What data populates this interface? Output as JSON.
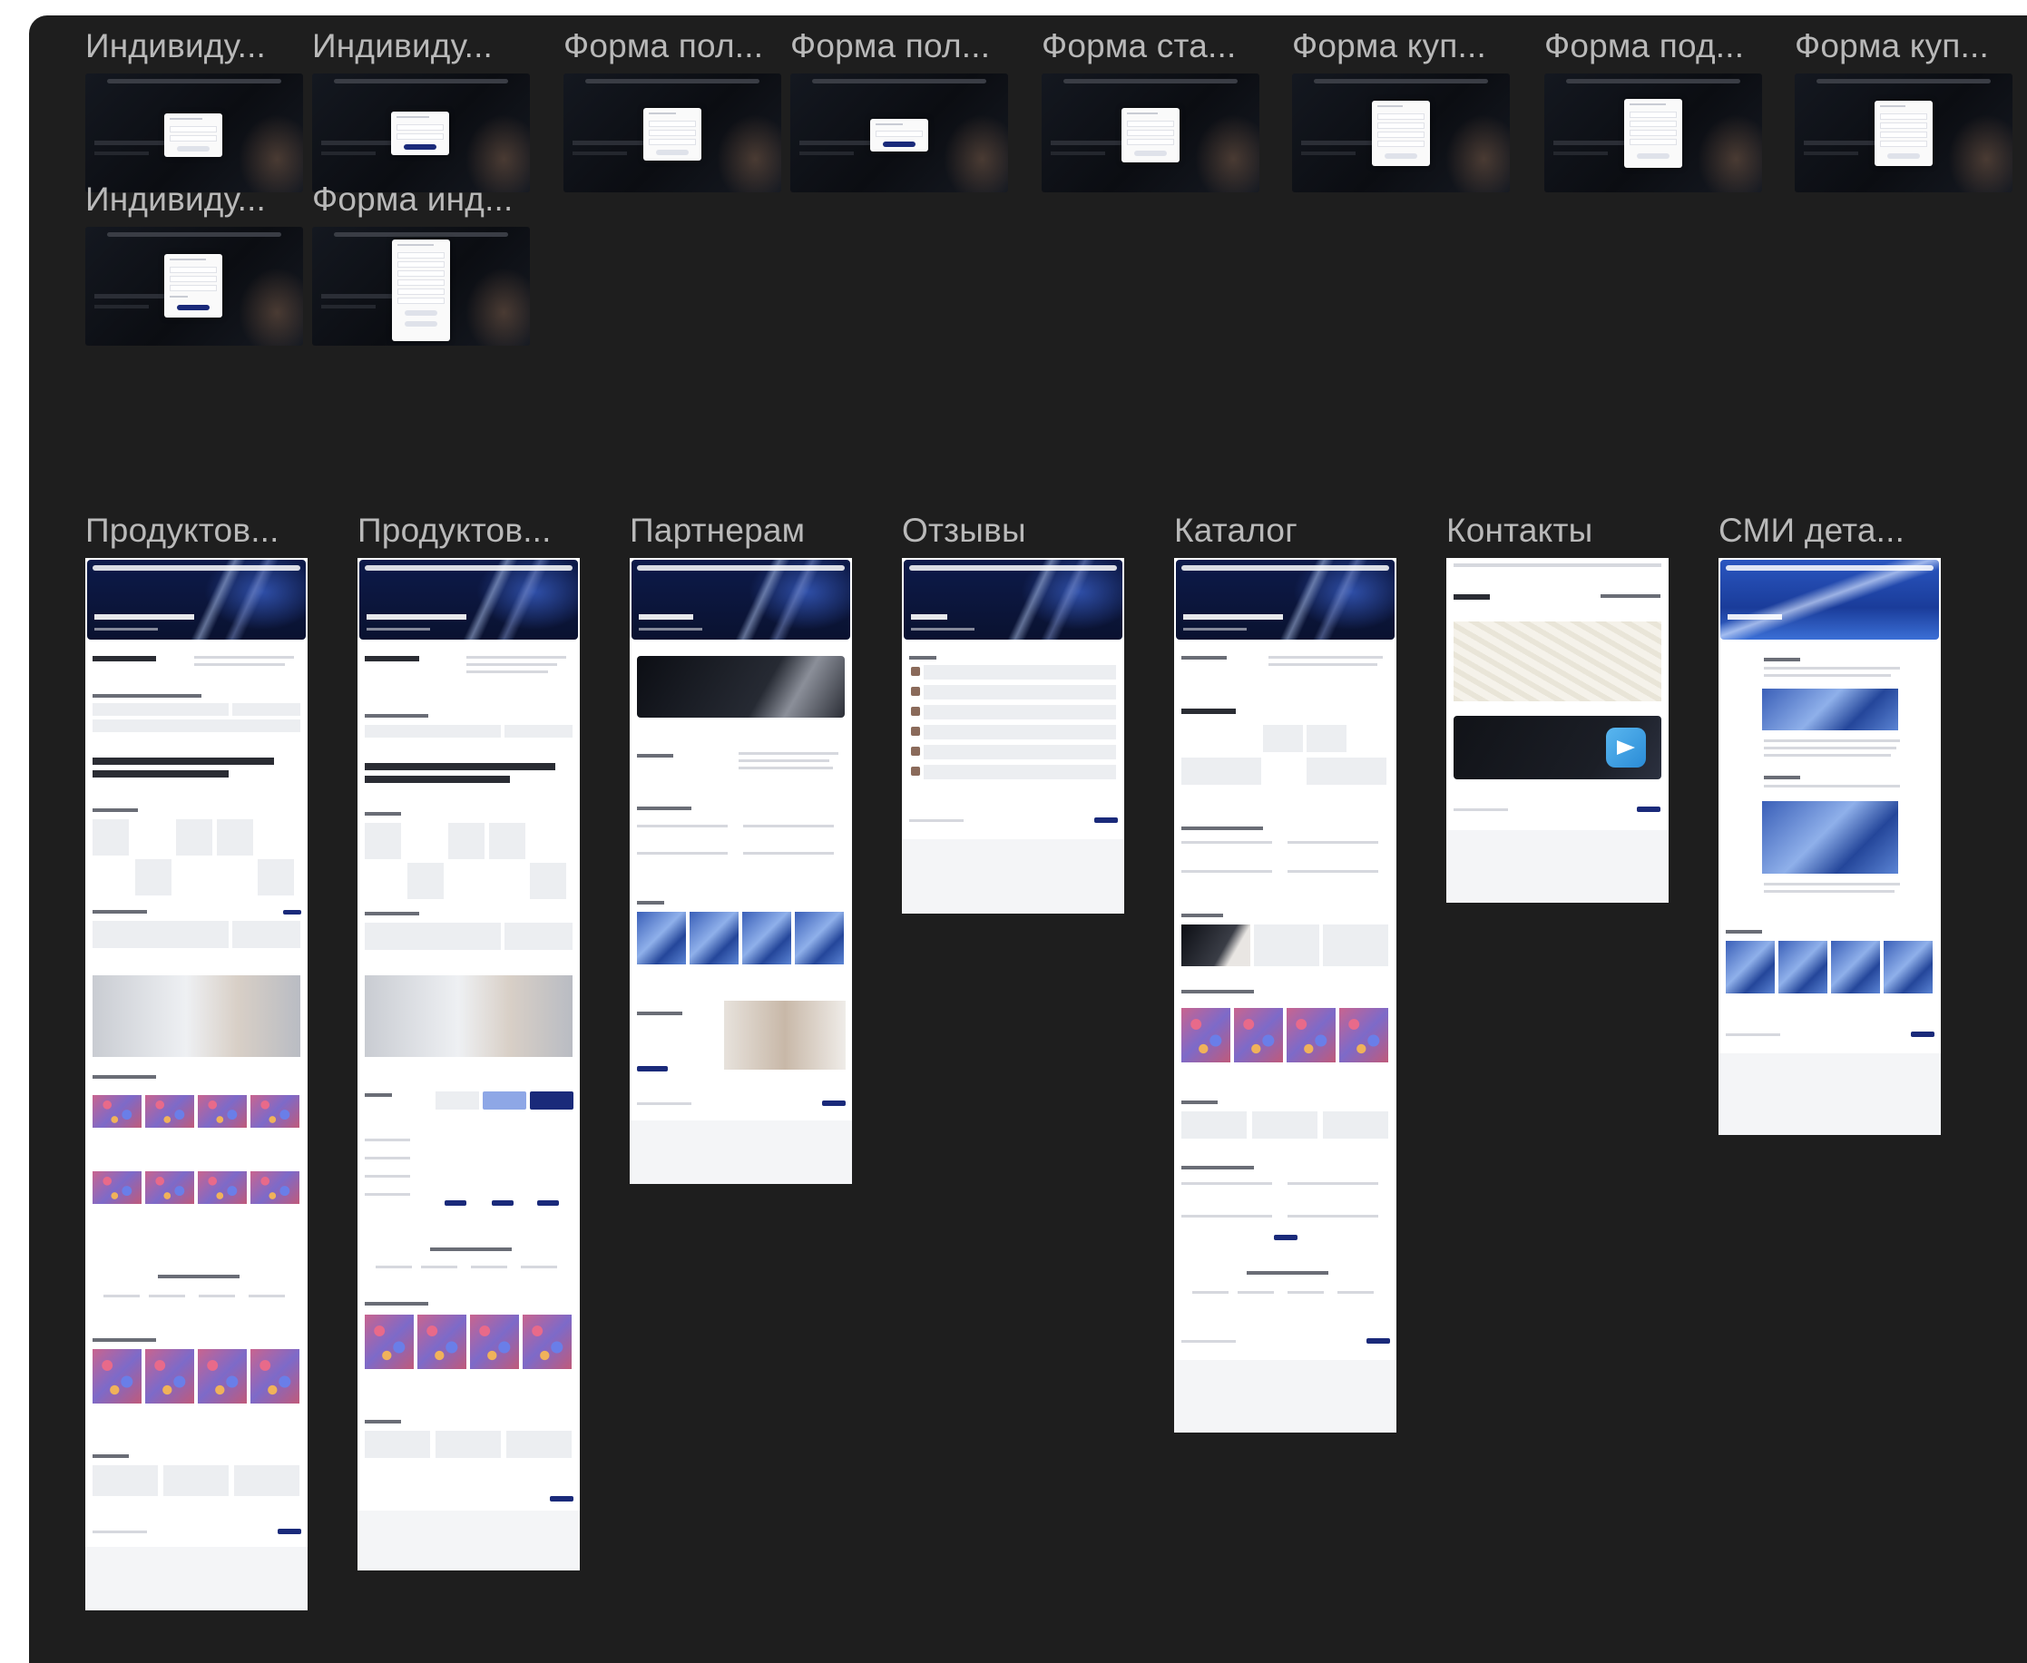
{
  "modal_frames": [
    {
      "title": "Индивиду..."
    },
    {
      "title": "Индивиду..."
    },
    {
      "title": "Форма пол..."
    },
    {
      "title": "Форма пол..."
    },
    {
      "title": "Форма ста..."
    },
    {
      "title": "Форма куп..."
    },
    {
      "title": "Форма под..."
    },
    {
      "title": "Форма куп..."
    },
    {
      "title": "Индивиду..."
    },
    {
      "title": "Форма инд..."
    }
  ],
  "page_frames": [
    {
      "title": "Продуктов..."
    },
    {
      "title": "Продуктов..."
    },
    {
      "title": "Партнерам"
    },
    {
      "title": "Отзывы"
    },
    {
      "title": "Каталог"
    },
    {
      "title": "Контакты"
    },
    {
      "title": "СМИ дета..."
    }
  ],
  "colors": {
    "canvas_bg": "#1e1e1e",
    "frame_title": "#b9b9b9",
    "brand_navy": "#1a2a7a"
  }
}
